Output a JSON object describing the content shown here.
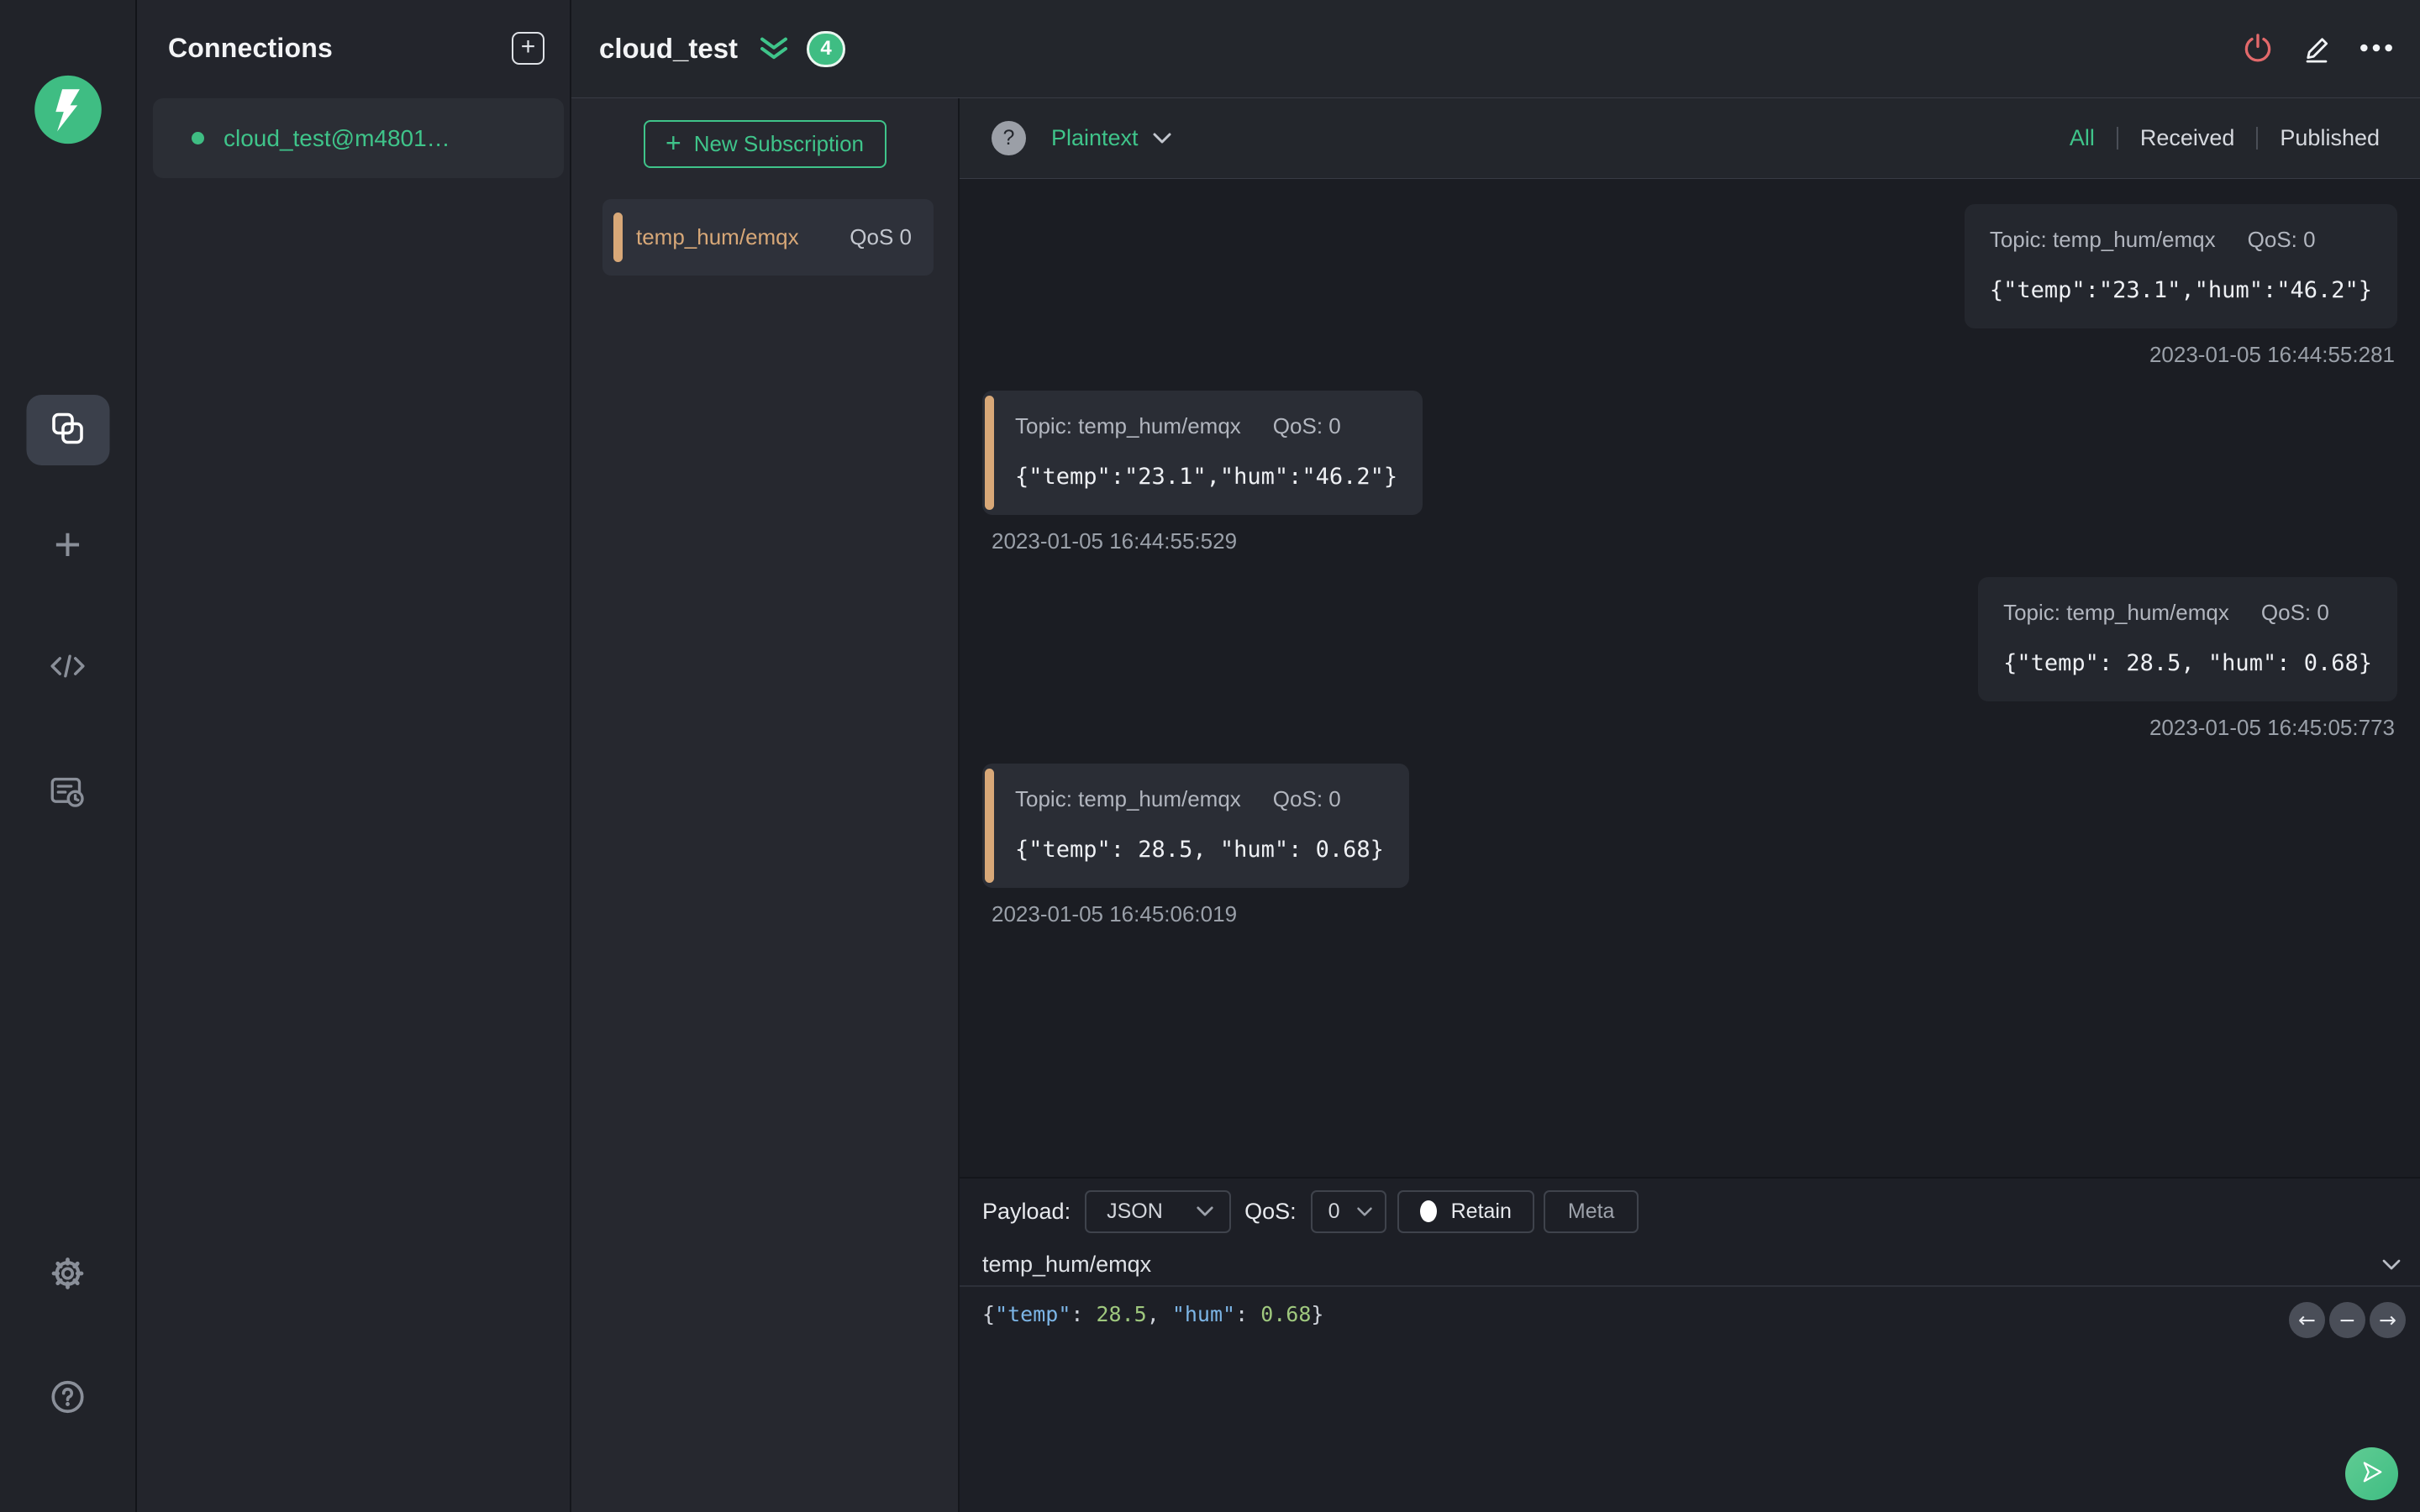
{
  "colors": {
    "accent_green": "#3fc48a",
    "badge_green": "#3fbd83",
    "topic_tan": "#d8a878",
    "power_red": "#e2696b"
  },
  "rail": {
    "icons": [
      "mqttx-logo",
      "connections",
      "new-connection",
      "script",
      "log",
      "settings",
      "help"
    ]
  },
  "connections": {
    "title": "Connections",
    "items": [
      {
        "name": "cloud_test@m4801…",
        "status": "connected"
      }
    ]
  },
  "header": {
    "title": "cloud_test",
    "badge_count": "4"
  },
  "subscriptions": {
    "new_button_label": "New Subscription",
    "items": [
      {
        "topic": "temp_hum/emqx",
        "qos": "QoS 0"
      }
    ]
  },
  "messages_panel": {
    "format_selected": "Plaintext",
    "filters": {
      "all": "All",
      "received": "Received",
      "published": "Published",
      "active": "All"
    },
    "messages": [
      {
        "direction": "published",
        "topic": "Topic: temp_hum/emqx",
        "qos": "QoS: 0",
        "payload": "{\"temp\":\"23.1\",\"hum\":\"46.2\"}",
        "timestamp": "2023-01-05 16:44:55:281"
      },
      {
        "direction": "received",
        "topic": "Topic: temp_hum/emqx",
        "qos": "QoS: 0",
        "payload": "{\"temp\":\"23.1\",\"hum\":\"46.2\"}",
        "timestamp": "2023-01-05 16:44:55:529"
      },
      {
        "direction": "published",
        "topic": "Topic: temp_hum/emqx",
        "qos": "QoS: 0",
        "payload": "{\"temp\": 28.5, \"hum\": 0.68}",
        "timestamp": "2023-01-05 16:45:05:773"
      },
      {
        "direction": "received",
        "topic": "Topic: temp_hum/emqx",
        "qos": "QoS: 0",
        "payload": "{\"temp\": 28.5, \"hum\": 0.68}",
        "timestamp": "2023-01-05 16:45:06:019"
      }
    ]
  },
  "publish": {
    "payload_label": "Payload:",
    "payload_format": "JSON",
    "qos_label": "QoS:",
    "qos_value": "0",
    "retain_label": "Retain",
    "meta_label": "Meta",
    "topic_value": "temp_hum/emqx",
    "editor_tokens": [
      {
        "text": "{",
        "type": "punc"
      },
      {
        "text": "\"temp\"",
        "type": "key"
      },
      {
        "text": ": ",
        "type": "punc"
      },
      {
        "text": "28.5",
        "type": "num"
      },
      {
        "text": ", ",
        "type": "punc"
      },
      {
        "text": "\"hum\"",
        "type": "key"
      },
      {
        "text": ": ",
        "type": "punc"
      },
      {
        "text": "0.68",
        "type": "num"
      },
      {
        "text": "}",
        "type": "punc"
      }
    ]
  }
}
